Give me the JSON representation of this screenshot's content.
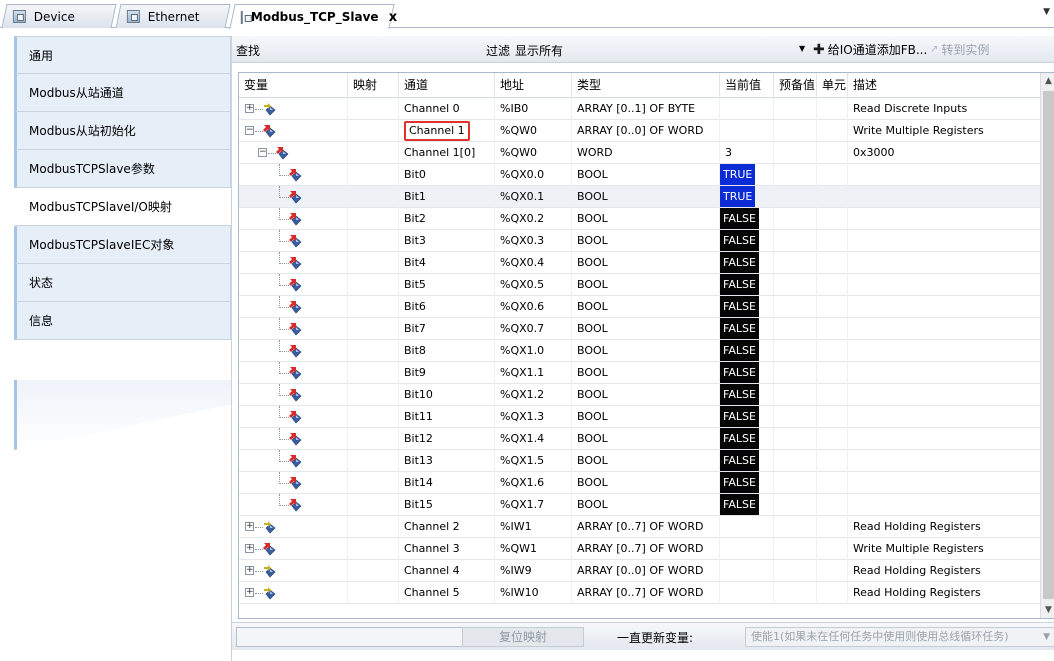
{
  "tabs": [
    {
      "label": "Device",
      "active": false,
      "closable": false
    },
    {
      "label": "Ethernet",
      "active": false,
      "closable": false
    },
    {
      "label": "Modbus_TCP_Slave",
      "active": true,
      "closable": true
    }
  ],
  "tab_close_glyph": "x",
  "tab_overflow_icon": "chevron-down-icon",
  "sidebar": {
    "items": [
      {
        "label": "通用",
        "active": false
      },
      {
        "label": "Modbus从站通道",
        "active": false
      },
      {
        "label": "Modbus从站初始化",
        "active": false
      },
      {
        "label": "ModbusTCPSlave参数",
        "active": false
      },
      {
        "label": "ModbusTCPSlaveI/O映射",
        "active": true
      },
      {
        "label": "ModbusTCPSlaveIEC对象",
        "active": false
      },
      {
        "label": "状态",
        "active": false
      },
      {
        "label": "信息",
        "active": false
      }
    ]
  },
  "toolbar": {
    "find_label": "查找",
    "filter_label": "过滤",
    "filter_value": "显示所有",
    "add_fb_label": "给IO通道添加FB...",
    "goto_instance_label": "转到实例"
  },
  "table": {
    "headers": {
      "variable": "变量",
      "mapping": "映射",
      "channel": "通道",
      "address": "地址",
      "type": "类型",
      "current_value": "当前值",
      "prepared_value": "预备值",
      "unit": "单元",
      "description": "描述"
    },
    "rows": [
      {
        "level": 0,
        "expander": "+",
        "icon": "input-channel-icon",
        "channel": "Channel 0",
        "address": "%IB0",
        "type": "ARRAY [0..1] OF BYTE",
        "current": "",
        "current_style": "",
        "description": "Read Discrete Inputs",
        "highlight": false,
        "selected": false
      },
      {
        "level": 0,
        "expander": "−",
        "icon": "output-channel-icon",
        "channel": "Channel 1",
        "address": "%QW0",
        "type": "ARRAY [0..0] OF WORD",
        "current": "",
        "current_style": "",
        "description": "Write Multiple Registers",
        "highlight": true,
        "selected": false
      },
      {
        "level": 1,
        "expander": "−",
        "icon": "output-channel-icon",
        "channel": "Channel 1[0]",
        "address": "%QW0",
        "type": "WORD",
        "current": "3",
        "current_style": "plain",
        "description": "0x3000",
        "highlight": false,
        "selected": false
      },
      {
        "level": 2,
        "expander": "",
        "icon": "output-bit-icon",
        "channel": "Bit0",
        "address": "%QX0.0",
        "type": "BOOL",
        "current": "TRUE",
        "current_style": "true",
        "description": "",
        "highlight": false,
        "selected": false
      },
      {
        "level": 2,
        "expander": "",
        "icon": "output-bit-icon",
        "channel": "Bit1",
        "address": "%QX0.1",
        "type": "BOOL",
        "current": "TRUE",
        "current_style": "true",
        "description": "",
        "highlight": false,
        "selected": true
      },
      {
        "level": 2,
        "expander": "",
        "icon": "output-bit-icon",
        "channel": "Bit2",
        "address": "%QX0.2",
        "type": "BOOL",
        "current": "FALSE",
        "current_style": "false",
        "description": "",
        "highlight": false,
        "selected": false
      },
      {
        "level": 2,
        "expander": "",
        "icon": "output-bit-icon",
        "channel": "Bit3",
        "address": "%QX0.3",
        "type": "BOOL",
        "current": "FALSE",
        "current_style": "false",
        "description": "",
        "highlight": false,
        "selected": false
      },
      {
        "level": 2,
        "expander": "",
        "icon": "output-bit-icon",
        "channel": "Bit4",
        "address": "%QX0.4",
        "type": "BOOL",
        "current": "FALSE",
        "current_style": "false",
        "description": "",
        "highlight": false,
        "selected": false
      },
      {
        "level": 2,
        "expander": "",
        "icon": "output-bit-icon",
        "channel": "Bit5",
        "address": "%QX0.5",
        "type": "BOOL",
        "current": "FALSE",
        "current_style": "false",
        "description": "",
        "highlight": false,
        "selected": false
      },
      {
        "level": 2,
        "expander": "",
        "icon": "output-bit-icon",
        "channel": "Bit6",
        "address": "%QX0.6",
        "type": "BOOL",
        "current": "FALSE",
        "current_style": "false",
        "description": "",
        "highlight": false,
        "selected": false
      },
      {
        "level": 2,
        "expander": "",
        "icon": "output-bit-icon",
        "channel": "Bit7",
        "address": "%QX0.7",
        "type": "BOOL",
        "current": "FALSE",
        "current_style": "false",
        "description": "",
        "highlight": false,
        "selected": false
      },
      {
        "level": 2,
        "expander": "",
        "icon": "output-bit-icon",
        "channel": "Bit8",
        "address": "%QX1.0",
        "type": "BOOL",
        "current": "FALSE",
        "current_style": "false",
        "description": "",
        "highlight": false,
        "selected": false
      },
      {
        "level": 2,
        "expander": "",
        "icon": "output-bit-icon",
        "channel": "Bit9",
        "address": "%QX1.1",
        "type": "BOOL",
        "current": "FALSE",
        "current_style": "false",
        "description": "",
        "highlight": false,
        "selected": false
      },
      {
        "level": 2,
        "expander": "",
        "icon": "output-bit-icon",
        "channel": "Bit10",
        "address": "%QX1.2",
        "type": "BOOL",
        "current": "FALSE",
        "current_style": "false",
        "description": "",
        "highlight": false,
        "selected": false
      },
      {
        "level": 2,
        "expander": "",
        "icon": "output-bit-icon",
        "channel": "Bit11",
        "address": "%QX1.3",
        "type": "BOOL",
        "current": "FALSE",
        "current_style": "false",
        "description": "",
        "highlight": false,
        "selected": false
      },
      {
        "level": 2,
        "expander": "",
        "icon": "output-bit-icon",
        "channel": "Bit12",
        "address": "%QX1.4",
        "type": "BOOL",
        "current": "FALSE",
        "current_style": "false",
        "description": "",
        "highlight": false,
        "selected": false
      },
      {
        "level": 2,
        "expander": "",
        "icon": "output-bit-icon",
        "channel": "Bit13",
        "address": "%QX1.5",
        "type": "BOOL",
        "current": "FALSE",
        "current_style": "false",
        "description": "",
        "highlight": false,
        "selected": false
      },
      {
        "level": 2,
        "expander": "",
        "icon": "output-bit-icon",
        "channel": "Bit14",
        "address": "%QX1.6",
        "type": "BOOL",
        "current": "FALSE",
        "current_style": "false",
        "description": "",
        "highlight": false,
        "selected": false
      },
      {
        "level": 2,
        "expander": "",
        "icon": "output-bit-icon",
        "channel": "Bit15",
        "address": "%QX1.7",
        "type": "BOOL",
        "current": "FALSE",
        "current_style": "false",
        "description": "",
        "highlight": false,
        "selected": false
      },
      {
        "level": 0,
        "expander": "+",
        "icon": "input-channel-icon",
        "channel": "Channel 2",
        "address": "%IW1",
        "type": "ARRAY [0..7] OF WORD",
        "current": "",
        "current_style": "",
        "description": "Read Holding Registers",
        "highlight": false,
        "selected": false
      },
      {
        "level": 0,
        "expander": "+",
        "icon": "output-channel-icon",
        "channel": "Channel 3",
        "address": "%QW1",
        "type": "ARRAY [0..7] OF WORD",
        "current": "",
        "current_style": "",
        "description": "Write Multiple Registers",
        "highlight": false,
        "selected": false
      },
      {
        "level": 0,
        "expander": "+",
        "icon": "input-channel-icon",
        "channel": "Channel 4",
        "address": "%IW9",
        "type": "ARRAY [0..0] OF WORD",
        "current": "",
        "current_style": "",
        "description": "Read Holding Registers",
        "highlight": false,
        "selected": false
      },
      {
        "level": 0,
        "expander": "+",
        "icon": "input-channel-icon",
        "channel": "Channel 5",
        "address": "%IW10",
        "type": "ARRAY [0..7] OF WORD",
        "current": "",
        "current_style": "",
        "description": "Read Holding Registers",
        "highlight": false,
        "selected": false
      }
    ]
  },
  "bottom": {
    "reset_mapping_label": "复位映射",
    "always_update_label": "一直更新变量:",
    "update_mode_value": "使能1(如果未在任何任务中使用则使用总线循环任务)"
  },
  "colors": {
    "true_bg": "#0a2bd6",
    "false_bg": "#050505",
    "highlight_border": "#e0322d",
    "nav_bg": "#e6eef7"
  }
}
